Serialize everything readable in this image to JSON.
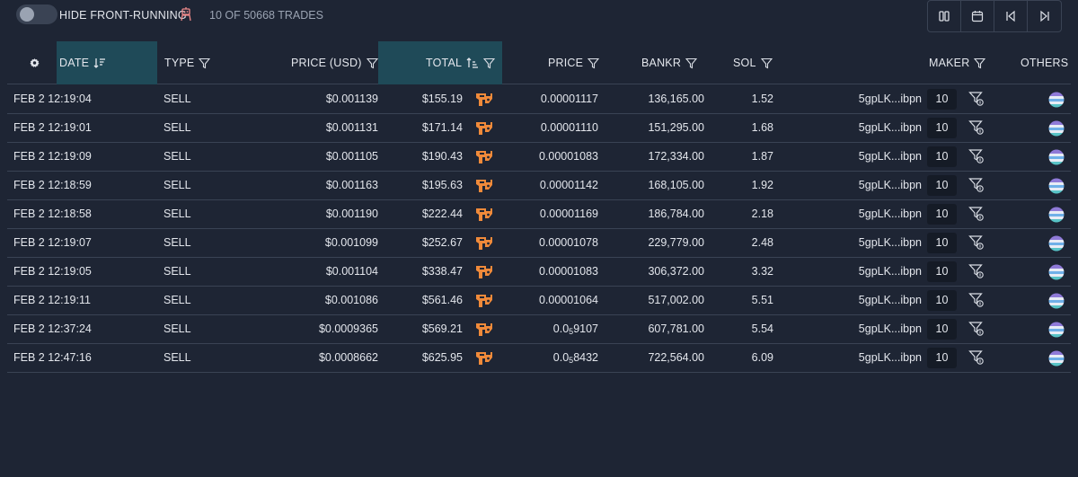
{
  "topbar": {
    "hide_label": "HIDE FRONT-RUNNING",
    "trades_count": "10 OF 50668 TRADES",
    "tools": [
      "pause-icon",
      "calendar-icon",
      "skip-back-icon",
      "skip-forward-icon"
    ]
  },
  "columns": {
    "date": "DATE",
    "type": "TYPE",
    "price_usd": "PRICE (USD)",
    "total": "TOTAL",
    "price": "PRICE",
    "bankr": "BANKR",
    "sol": "SOL",
    "maker": "MAKER",
    "others": "OTHERS"
  },
  "colors": {
    "background": "#1e2534",
    "active_header": "#1f4a58",
    "sell_text": "#e3e6ec",
    "tx_icon": "#f08a3a"
  },
  "rows": [
    {
      "date": "FEB 2 12:19:04",
      "type": "SELL",
      "price_usd": "$0.001139",
      "total": "$155.19",
      "price": "0.00001117",
      "price_sub": "",
      "price_tail": "",
      "bankr": "136,165.00",
      "sol": "1.52",
      "maker": "5gpLK...ibpn",
      "maker_count": "10"
    },
    {
      "date": "FEB 2 12:19:01",
      "type": "SELL",
      "price_usd": "$0.001131",
      "total": "$171.14",
      "price": "0.00001110",
      "price_sub": "",
      "price_tail": "",
      "bankr": "151,295.00",
      "sol": "1.68",
      "maker": "5gpLK...ibpn",
      "maker_count": "10"
    },
    {
      "date": "FEB 2 12:19:09",
      "type": "SELL",
      "price_usd": "$0.001105",
      "total": "$190.43",
      "price": "0.00001083",
      "price_sub": "",
      "price_tail": "",
      "bankr": "172,334.00",
      "sol": "1.87",
      "maker": "5gpLK...ibpn",
      "maker_count": "10"
    },
    {
      "date": "FEB 2 12:18:59",
      "type": "SELL",
      "price_usd": "$0.001163",
      "total": "$195.63",
      "price": "0.00001142",
      "price_sub": "",
      "price_tail": "",
      "bankr": "168,105.00",
      "sol": "1.92",
      "maker": "5gpLK...ibpn",
      "maker_count": "10"
    },
    {
      "date": "FEB 2 12:18:58",
      "type": "SELL",
      "price_usd": "$0.001190",
      "total": "$222.44",
      "price": "0.00001169",
      "price_sub": "",
      "price_tail": "",
      "bankr": "186,784.00",
      "sol": "2.18",
      "maker": "5gpLK...ibpn",
      "maker_count": "10"
    },
    {
      "date": "FEB 2 12:19:07",
      "type": "SELL",
      "price_usd": "$0.001099",
      "total": "$252.67",
      "price": "0.00001078",
      "price_sub": "",
      "price_tail": "",
      "bankr": "229,779.00",
      "sol": "2.48",
      "maker": "5gpLK...ibpn",
      "maker_count": "10"
    },
    {
      "date": "FEB 2 12:19:05",
      "type": "SELL",
      "price_usd": "$0.001104",
      "total": "$338.47",
      "price": "0.00001083",
      "price_sub": "",
      "price_tail": "",
      "bankr": "306,372.00",
      "sol": "3.32",
      "maker": "5gpLK...ibpn",
      "maker_count": "10"
    },
    {
      "date": "FEB 2 12:19:11",
      "type": "SELL",
      "price_usd": "$0.001086",
      "total": "$561.46",
      "price": "0.00001064",
      "price_sub": "",
      "price_tail": "",
      "bankr": "517,002.00",
      "sol": "5.51",
      "maker": "5gpLK...ibpn",
      "maker_count": "10"
    },
    {
      "date": "FEB 2 12:37:24",
      "type": "SELL",
      "price_usd": "$0.0009365",
      "total": "$569.21",
      "price": "0.0",
      "price_sub": "5",
      "price_tail": "9107",
      "bankr": "607,781.00",
      "sol": "5.54",
      "maker": "5gpLK...ibpn",
      "maker_count": "10"
    },
    {
      "date": "FEB 2 12:47:16",
      "type": "SELL",
      "price_usd": "$0.0008662",
      "total": "$625.95",
      "price": "0.0",
      "price_sub": "5",
      "price_tail": "8432",
      "bankr": "722,564.00",
      "sol": "6.09",
      "maker": "5gpLK...ibpn",
      "maker_count": "10"
    }
  ]
}
